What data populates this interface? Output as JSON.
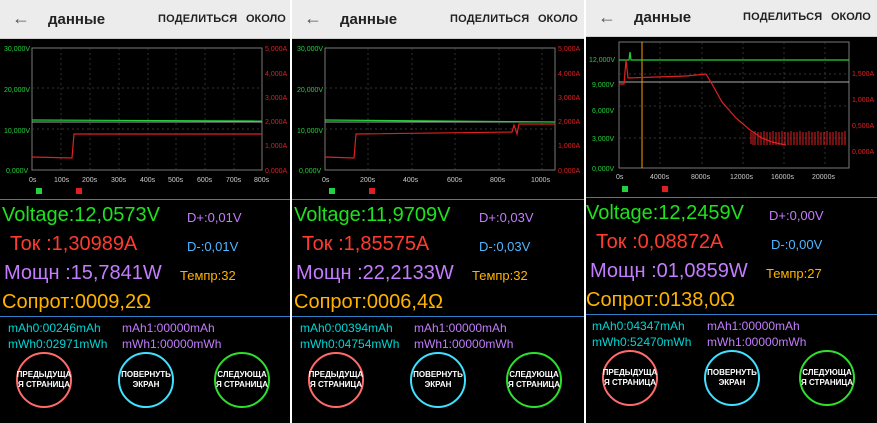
{
  "appbar": {
    "back_label": "←",
    "title": "данные",
    "share": "ПОДЕЛИТЬСЯ",
    "about": "ОКОЛО"
  },
  "colors": {
    "voltage": "#1ee21e",
    "current": "#ff3b30",
    "power": "#c47cff",
    "resistance": "#ffb300",
    "separator": "#2f80c8"
  },
  "buttons": {
    "prev_line1": "ПРЕДЫДУЩА",
    "prev_line2": "Я СТРАНИЦА",
    "rotate_line1": "ПОВЕРНУТЬ",
    "rotate_line2": "ЭКРАН",
    "next_line1": "СЛЕДУЮЩА",
    "next_line2": "Я СТРАНИЦА"
  },
  "panels": [
    {
      "chart": {
        "left_ticks": [
          "30,000V",
          "20,000V",
          "10,000V",
          "0,000V"
        ],
        "right_ticks": [
          "5,000A",
          "4,000A",
          "3,000A",
          "2,000A",
          "1,000A",
          "0,000A"
        ],
        "x_ticks": [
          "0s",
          "100s",
          "200s",
          "300s",
          "400s",
          "500s",
          "600s",
          "700s",
          "800s"
        ]
      },
      "voltage": "Voltage:12,0573V",
      "dplus": "D+:0,01V",
      "tok": "Ток    :1,30989A",
      "dminus": "D-:0,01V",
      "power": "Мощн :15,7841W",
      "temp": "Темпр:32",
      "resistance": "Сопрот:0009,2Ω",
      "mah0": "mAh0:00246mAh",
      "mah1": "mAh1:00000mAh",
      "mwh0": "mWh0:02971mWh",
      "mwh1": "mWh1:00000mWh"
    },
    {
      "chart": {
        "left_ticks": [
          "30,000V",
          "20,000V",
          "10,000V",
          "0,000V"
        ],
        "right_ticks": [
          "5,000A",
          "4,000A",
          "3,000A",
          "2,000A",
          "1,000A",
          "0,000A"
        ],
        "x_ticks": [
          "0s",
          "200s",
          "400s",
          "600s",
          "800s",
          "1000s"
        ]
      },
      "voltage": "Voltage:11,9709V",
      "dplus": "D+:0,03V",
      "tok": "Ток    :1,85575A",
      "dminus": "D-:0,03V",
      "power": "Мощн :22,2133W",
      "temp": "Темпр:32",
      "resistance": "Сопрот:0006,4Ω",
      "mah0": "mAh0:00394mAh",
      "mah1": "mAh1:00000mAh",
      "mwh0": "mWh0:04754mWh",
      "mwh1": "mWh1:00000mWh"
    },
    {
      "chart": {
        "left_ticks": [
          "12,000V",
          "9,000V",
          "6,000V",
          "3,000V",
          "0,000V"
        ],
        "right_ticks": [
          "1,500A",
          "1,000A",
          "0,500A",
          "0,000A"
        ],
        "x_ticks": [
          "0s",
          "4000s",
          "8000s",
          "12000s",
          "16000s",
          "20000s"
        ]
      },
      "voltage": "Voltage:12,2459V",
      "dplus": "D+:0,00V",
      "tok": "Ток    :0,08872A",
      "dminus": "D-:0,00V",
      "power": "Мощн :01,0859W",
      "temp": "Темпр:27",
      "resistance": "Сопрот:0138,0Ω",
      "mah0": "mAh0:04347mAh",
      "mah1": "mAh1:00000mAh",
      "mwh0": "mWh0:52470mWh",
      "mwh1": "mWh1:00000mWh"
    }
  ]
}
